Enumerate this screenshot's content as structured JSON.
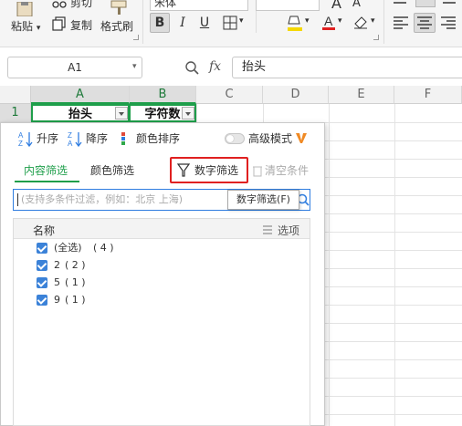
{
  "ribbon": {
    "cut": "剪切",
    "paste": "粘贴",
    "copy": "复制",
    "format_painter": "格式刷",
    "font_name": "宋体",
    "bold": "B",
    "italic": "I",
    "underline": "U",
    "font_grow": "A",
    "font_shrink": "A"
  },
  "formula_bar": {
    "name_box": "A1",
    "fx": "fx",
    "value": "抬头"
  },
  "grid": {
    "columns": [
      "A",
      "B",
      "C",
      "D",
      "E",
      "F"
    ],
    "rows": [
      "1"
    ],
    "cells": {
      "a1": "抬头",
      "b1": "字符数"
    }
  },
  "filter_panel": {
    "sort_asc": "升序",
    "sort_desc": "降序",
    "color_sort": "颜色排序",
    "advanced_mode": "高级模式",
    "tab_content": "内容筛选",
    "tab_color": "颜色筛选",
    "number_filter": "数字筛选",
    "clear_conditions": "清空条件",
    "search_placeholder": "(支持多条件过滤，例如：北京  上海)",
    "list_header": "名称",
    "options": "选项",
    "items": [
      {
        "label": "(全选)",
        "count": "( 4 )"
      },
      {
        "label": "2",
        "count": "( 2 )"
      },
      {
        "label": "5",
        "count": "( 1 )"
      },
      {
        "label": "9",
        "count": "( 1 )"
      }
    ],
    "tooltip": "数字筛选(F)"
  },
  "colors": {
    "accent_green": "#1e9e4a",
    "highlight_red": "#e02020",
    "checkbox_blue": "#3b82d8"
  }
}
